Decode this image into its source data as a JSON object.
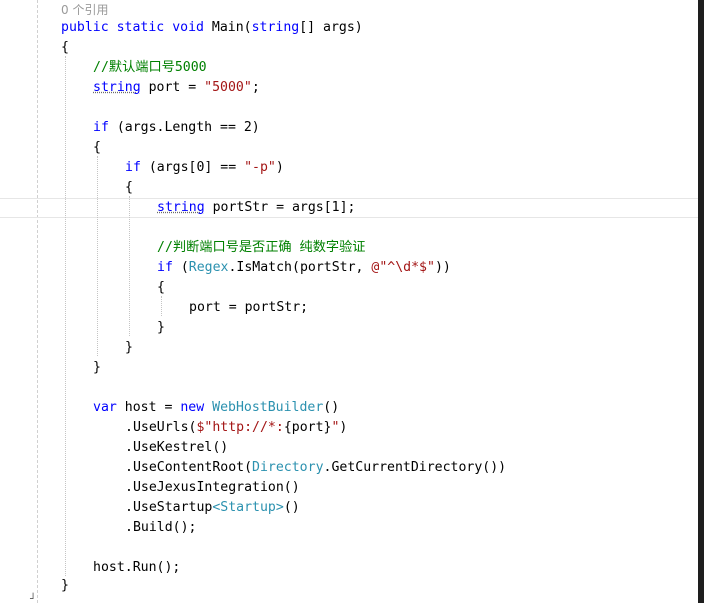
{
  "editor": {
    "codelens_references": "0 个引用",
    "lines": {
      "main_signature": {
        "kw1": "public",
        "kw2": "static",
        "kw3": "void",
        "name": " Main(",
        "kw4": "string",
        "rest": "[] args)"
      },
      "open_brace_1": "{",
      "comment_default_port": "//默认端口号5000",
      "port_decl": {
        "kw": "string",
        "mid": " port = ",
        "str": "\"5000\"",
        "end": ";"
      },
      "if_args_length": {
        "kw": "if",
        "rest": " (args.Length == 2)"
      },
      "open_brace_2": "{",
      "if_args_p": {
        "kw": "if",
        "rest": " (args[0] == ",
        "str": "\"-p\"",
        "end": ")"
      },
      "open_brace_3": "{",
      "portstr_decl": {
        "kw": "string",
        "rest": " portStr = args[1];"
      },
      "comment_check_port": "//判断端口号是否正确 纯数字验证",
      "if_regex": {
        "kw": "if",
        "open": " (",
        "type": "Regex",
        "mid": ".IsMatch(portStr, ",
        "str": "@\"^\\d*$\"",
        "end": "))"
      },
      "open_brace_4": "{",
      "port_assign": "port = portStr;",
      "close_brace_4": "}",
      "close_brace_3": "}",
      "close_brace_2": "}",
      "host_decl": {
        "kw1": "var",
        "mid": " host = ",
        "kw2": "new",
        "type": " WebHostBuilder",
        "end": "()"
      },
      "use_urls": {
        "pre": ".UseUrls(",
        "str1": "$\"http://*:",
        "interp": "{port}",
        "str2": "\"",
        "end": ")"
      },
      "use_kestrel": ".UseKestrel()",
      "use_content_root": {
        "pre": ".UseContentRoot(",
        "type": "Directory",
        "end": ".GetCurrentDirectory())"
      },
      "use_jexus": ".UseJexusIntegration()",
      "use_startup": {
        "pre": ".UseStartup",
        "type": "<Startup>",
        "end": "()"
      },
      "build": ".Build();",
      "host_run": "host.Run();",
      "close_brace_1": "}"
    }
  },
  "colors": {
    "keyword": "#0000ff",
    "type": "#2b91af",
    "string": "#a31515",
    "comment": "#008000",
    "codelens": "#9a9a9a"
  }
}
